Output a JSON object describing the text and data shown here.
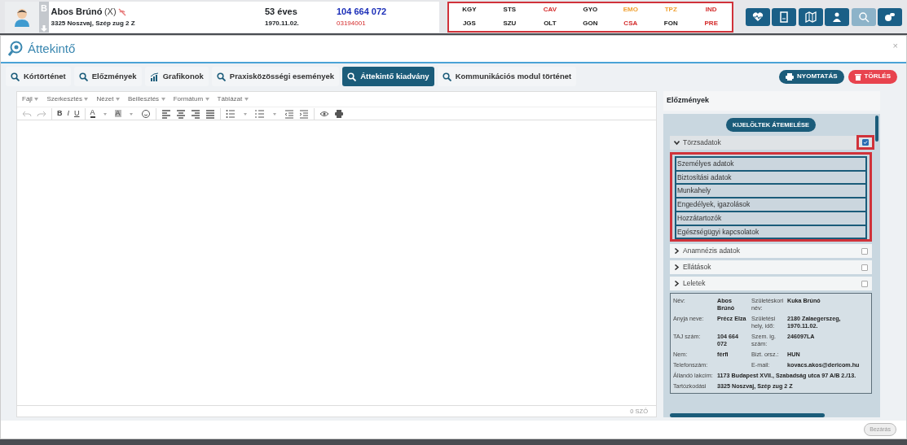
{
  "patient": {
    "initial": "B",
    "name": "Abos Brúnó",
    "name_suffix": "(X)",
    "address": "3325 Noszvaj, Szép zug 2 Z",
    "age": "53 éves",
    "birth_date": "1970.11.02.",
    "taj": "104 664 072",
    "id_number": "03194001"
  },
  "codes": [
    {
      "label": "KGY",
      "color": "#222222"
    },
    {
      "label": "STS",
      "color": "#222222"
    },
    {
      "label": "CAV",
      "color": "#d42a2a"
    },
    {
      "label": "GYO",
      "color": "#222222"
    },
    {
      "label": "EMO",
      "color": "#f0a030"
    },
    {
      "label": "TPZ",
      "color": "#f0a030"
    },
    {
      "label": "IND",
      "color": "#d42a2a"
    },
    {
      "label": "JGS",
      "color": "#222222"
    },
    {
      "label": "SZU",
      "color": "#222222"
    },
    {
      "label": "OLT",
      "color": "#222222"
    },
    {
      "label": "GON",
      "color": "#222222"
    },
    {
      "label": "CSA",
      "color": "#d42a2a"
    },
    {
      "label": "FON",
      "color": "#222222"
    },
    {
      "label": "PRE",
      "color": "#d42a2a"
    }
  ],
  "header_buttons": [
    {
      "kind": "heart",
      "disabled": false
    },
    {
      "kind": "document",
      "disabled": false
    },
    {
      "kind": "map",
      "disabled": false
    },
    {
      "kind": "person",
      "disabled": false
    },
    {
      "kind": "search",
      "disabled": true
    },
    {
      "kind": "pills",
      "disabled": false
    }
  ],
  "modal": {
    "title": "Áttekintő",
    "close": "×",
    "close_button": "Bezárás"
  },
  "tabs": [
    {
      "label": "Kórtörténet",
      "kind": "search",
      "selected": false
    },
    {
      "label": "Előzmények",
      "kind": "search",
      "selected": false
    },
    {
      "label": "Grafikonok",
      "kind": "chart",
      "selected": false
    },
    {
      "label": "Praxisközösségi események",
      "kind": "search",
      "selected": false
    },
    {
      "label": "Áttekintő kiadvány",
      "kind": "search",
      "selected": true
    },
    {
      "label": "Kommunikációs modul történet",
      "kind": "search",
      "selected": false
    }
  ],
  "actions": [
    {
      "label": "NYOMTATÁS",
      "kind": "print"
    },
    {
      "label": "TÖRLÉS",
      "kind": "delete"
    }
  ],
  "editor": {
    "menu": [
      "Fájl",
      "Szerkesztés",
      "Nézet",
      "Beillesztés",
      "Formátum",
      "Táblázat"
    ],
    "toolbar": [
      {
        "kind": "undo"
      },
      {
        "kind": "redo"
      },
      {
        "kind": "sep"
      },
      {
        "kind": "bold",
        "label": "B"
      },
      {
        "kind": "italic",
        "label": "I"
      },
      {
        "kind": "underline",
        "label": "U"
      },
      {
        "kind": "sep"
      },
      {
        "kind": "color",
        "label": "A"
      },
      {
        "kind": "caret"
      },
      {
        "kind": "highlight",
        "label": "A"
      },
      {
        "kind": "caret"
      },
      {
        "kind": "emoji"
      },
      {
        "kind": "sep"
      },
      {
        "kind": "align-left"
      },
      {
        "kind": "align-center"
      },
      {
        "kind": "align-right"
      },
      {
        "kind": "justify"
      },
      {
        "kind": "sep"
      },
      {
        "kind": "bullets"
      },
      {
        "kind": "caret"
      },
      {
        "kind": "numbers"
      },
      {
        "kind": "caret"
      },
      {
        "kind": "outdent"
      },
      {
        "kind": "indent"
      },
      {
        "kind": "sep"
      },
      {
        "kind": "preview"
      },
      {
        "kind": "print"
      }
    ],
    "word_count": "0 SZÓ"
  },
  "side_panel": {
    "title": "Előzmények",
    "transfer_button": "KIJELÖLTEK ÁTEMELÉSE",
    "sections": [
      {
        "label": "Törzsadatok",
        "expanded": true,
        "checked": true,
        "highlighted": true,
        "children": [
          "Személyes adatok",
          "Biztosítási adatok",
          "Munkahely",
          "Engedélyek, igazolások",
          "Hozzátartozók",
          "Egészségügyi kapcsolatok"
        ]
      },
      {
        "label": "Anamnézis adatok",
        "expanded": false,
        "checked": false,
        "highlighted": false
      },
      {
        "label": "Ellátások",
        "expanded": false,
        "checked": false,
        "highlighted": false
      },
      {
        "label": "Leletek",
        "expanded": false,
        "checked": false,
        "highlighted": false
      }
    ],
    "details": [
      {
        "kind": "pair",
        "label": "Név:",
        "value": "Abos Brúnó",
        "label2": "Születéskori név:",
        "value2": "Kuka Brúnó"
      },
      {
        "kind": "pair",
        "label": "Anyja neve:",
        "value": "Précz Elza",
        "label2": "Születési hely, idő:",
        "value2": "2180 Zalaegerszeg, 1970.11.02."
      },
      {
        "kind": "pair",
        "label": "TAJ szám:",
        "value": "104 664 072",
        "label2": "Szem. ig. szám:",
        "value2": "246097LA"
      },
      {
        "kind": "pair",
        "label": "Nem:",
        "value": "férfi",
        "label2": "Bizt. orsz.:",
        "value2": "HUN"
      },
      {
        "kind": "pair",
        "label": "Telefonszám:",
        "value2": "kovacs.akos@dericom.hu",
        "label2": "E-mail:"
      },
      {
        "kind": "wide",
        "label": "Állandó lakcím:",
        "value": "1173 Budapest XVII., Szabadság utca 97 A/B 2./13."
      },
      {
        "kind": "wide",
        "label": "Tartózkodási",
        "value": "3325 Noszvaj, Szép zug 2 Z"
      }
    ]
  }
}
